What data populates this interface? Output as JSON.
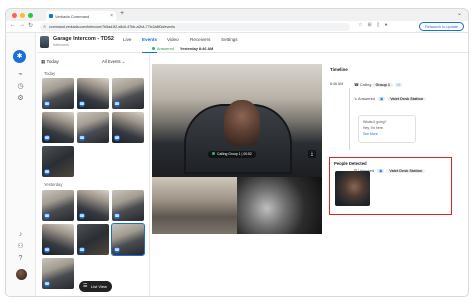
{
  "browser": {
    "tab_title": "Verkada Command",
    "url": "command.verkada.com/intercom/7b5ad1f2-e8c6-47bb-a2b4-77fc2a8f0d/events",
    "update_label": "Relaunch to update"
  },
  "header": {
    "title": "Garage Intercom - TD52",
    "subtitle": "Intercoms",
    "tabs": [
      "Live",
      "Events",
      "Video",
      "Receivers",
      "Settings"
    ],
    "active_tab": "Events"
  },
  "events": {
    "date_label": "Today",
    "filter_label": "All Events",
    "sections": [
      "Today",
      "Yesterday"
    ],
    "list_view_label": "List View"
  },
  "player": {
    "status_label": "Answered",
    "timestamp": "Yesterday 8:46 AM",
    "call_label": "Calling Group 1",
    "call_time": "00:52"
  },
  "timeline": {
    "title": "Timeline",
    "time": "8:46 AM",
    "rows": [
      {
        "action": "Calling",
        "target": "Group 1"
      },
      {
        "action": "Answered",
        "target": "Valet Desk Station"
      },
      {
        "action": "Unlocked",
        "target": "Valet Desk Station"
      },
      {
        "action": "Ended",
        "target": ""
      }
    ],
    "messages": [
      "Whats it going?",
      "Hey, I'm here.",
      "See More"
    ]
  },
  "people": {
    "title": "People Detected"
  },
  "colors": {
    "accent": "#1a6edb",
    "highlight_border": "#e02424",
    "live_dot": "#2bb673"
  }
}
